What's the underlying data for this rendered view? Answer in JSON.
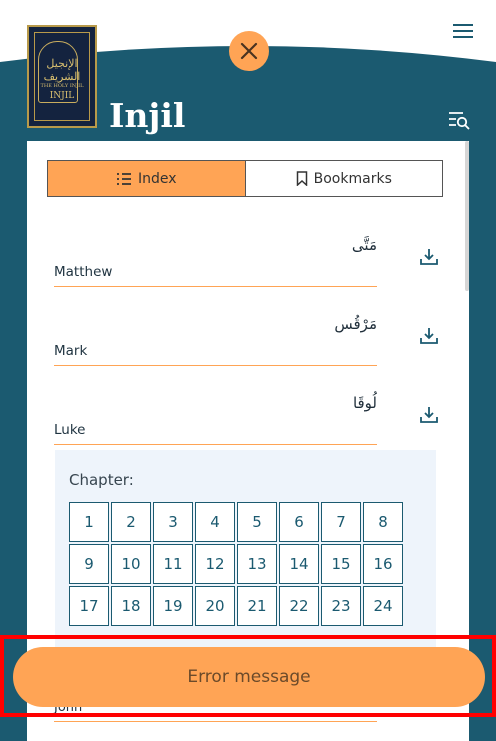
{
  "app": {
    "title": "Injil"
  },
  "logo": {
    "arabic": "الإنجيل الشريف",
    "line1": "THE HOLY INJIL",
    "line2": "INJIL"
  },
  "tabs": [
    {
      "label": "Index",
      "icon": "list-icon",
      "active": true
    },
    {
      "label": "Bookmarks",
      "icon": "bookmark-icon",
      "active": false
    }
  ],
  "books": [
    {
      "arabic": "مَتَّى",
      "name": "Matthew"
    },
    {
      "arabic": "مَرْقُس",
      "name": "Mark"
    },
    {
      "arabic": "لُوقَا",
      "name": "Luke"
    },
    {
      "arabic": "",
      "name": "John"
    }
  ],
  "chapters": {
    "label": "Chapter:",
    "numbers": [
      "1",
      "2",
      "3",
      "4",
      "5",
      "6",
      "7",
      "8",
      "9",
      "10",
      "11",
      "12",
      "13",
      "14",
      "15",
      "16",
      "17",
      "18",
      "19",
      "20",
      "21",
      "22",
      "23",
      "24"
    ]
  },
  "toast": {
    "message": "Error message"
  },
  "colors": {
    "teal": "#1b5a70",
    "accent": "#ffa455",
    "chapter_bg": "#eef4fb",
    "error_outline": "#ff0000"
  }
}
